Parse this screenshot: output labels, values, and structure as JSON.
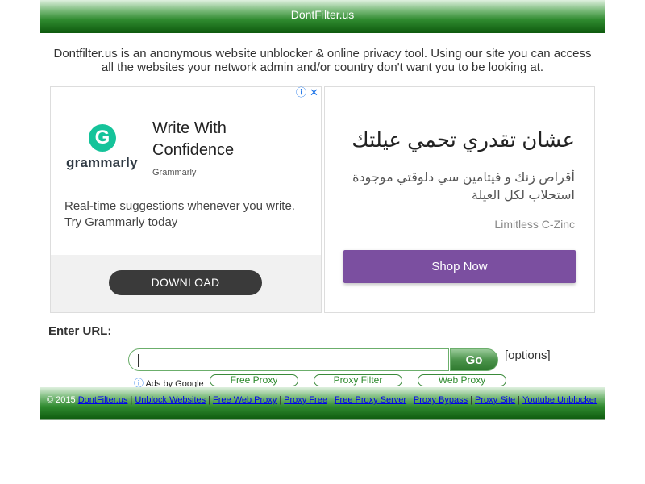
{
  "site": {
    "title": "DontFilter.us",
    "intro": "Dontfilter.us is an anonymous website unblocker & online privacy tool. Using our site you can access all the websites your network admin and/or country don't want you to be looking at."
  },
  "ad_left": {
    "logo_letter": "G",
    "logo_text": "grammarly",
    "title": "Write With Confidence",
    "brand": "Grammarly",
    "description": "Real-time suggestions whenever you write. Try Grammarly today",
    "button": "DOWNLOAD"
  },
  "ad_right": {
    "title": "عشان تقدري تحمي عيلتك",
    "description": "أقراص زنك و فيتامين سي دلوقتي موجودة استحلاب لكل العيلة",
    "brand": "Limitless C-Zinc",
    "button": "Shop Now"
  },
  "adchoices": {
    "info_glyph": "ⓘ",
    "close_glyph": "✕"
  },
  "form": {
    "label": "Enter URL:",
    "url_value": "",
    "go_label": "Go",
    "options_label": "[options]"
  },
  "ads_by_google": "Ads by Google",
  "link_pills": [
    "Free Proxy",
    "Proxy Filter",
    "Web Proxy"
  ],
  "footer": {
    "copyright": "© 2015",
    "links": [
      "DontFilter.us",
      "Unblock Websites",
      "Free Web Proxy",
      "Proxy Free",
      "Free Proxy Server",
      "Proxy Bypass",
      "Proxy Site",
      "Youtube Unblocker"
    ]
  },
  "colors": {
    "header_green": "#2f8a2f",
    "ad_button_purple": "#7b4fa0",
    "grammarly_green": "#15c39a"
  }
}
